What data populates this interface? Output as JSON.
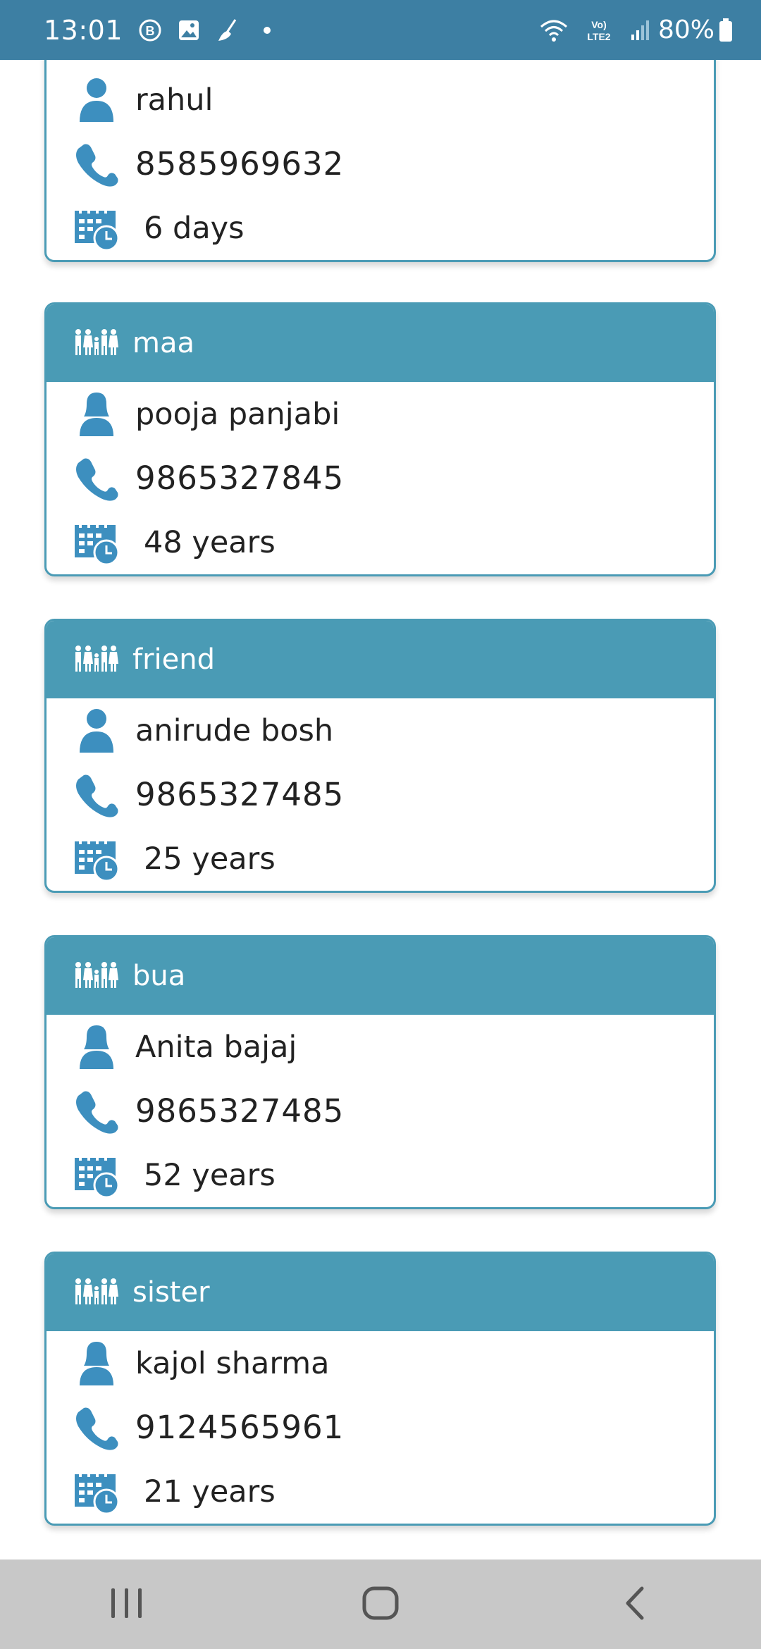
{
  "status_bar": {
    "time": "13:01",
    "battery": "80%",
    "icons": [
      "b-circle-icon",
      "image-icon",
      "broom-icon",
      "dot-icon",
      "wifi-icon",
      "volte-icon",
      "signal-icon",
      "battery-icon"
    ],
    "network_label": "Vo) LTE2"
  },
  "contacts": [
    {
      "relation": "",
      "name": "rahul",
      "phone": "8585969632",
      "duration": "6 days",
      "header_visible": false
    },
    {
      "relation": "maa",
      "name": "pooja panjabi",
      "phone": "9865327845",
      "duration": "48 years"
    },
    {
      "relation": "friend",
      "name": "anirude bosh",
      "phone": "9865327485",
      "duration": "25 years"
    },
    {
      "relation": "bua",
      "name": "Anita bajaj",
      "phone": "9865327485",
      "duration": "52 years"
    },
    {
      "relation": "sister",
      "name": "kajol sharma",
      "phone": "9124565961",
      "duration": "21 years"
    }
  ],
  "nav_bar": {
    "buttons": [
      "recents-icon",
      "home-icon",
      "back-icon"
    ]
  },
  "colors": {
    "status_bar": "#3d7fa3",
    "accent": "#4a9bb5",
    "icon": "#3d8fbf",
    "nav_bar": "#c8c8c8",
    "text": "#222222"
  }
}
